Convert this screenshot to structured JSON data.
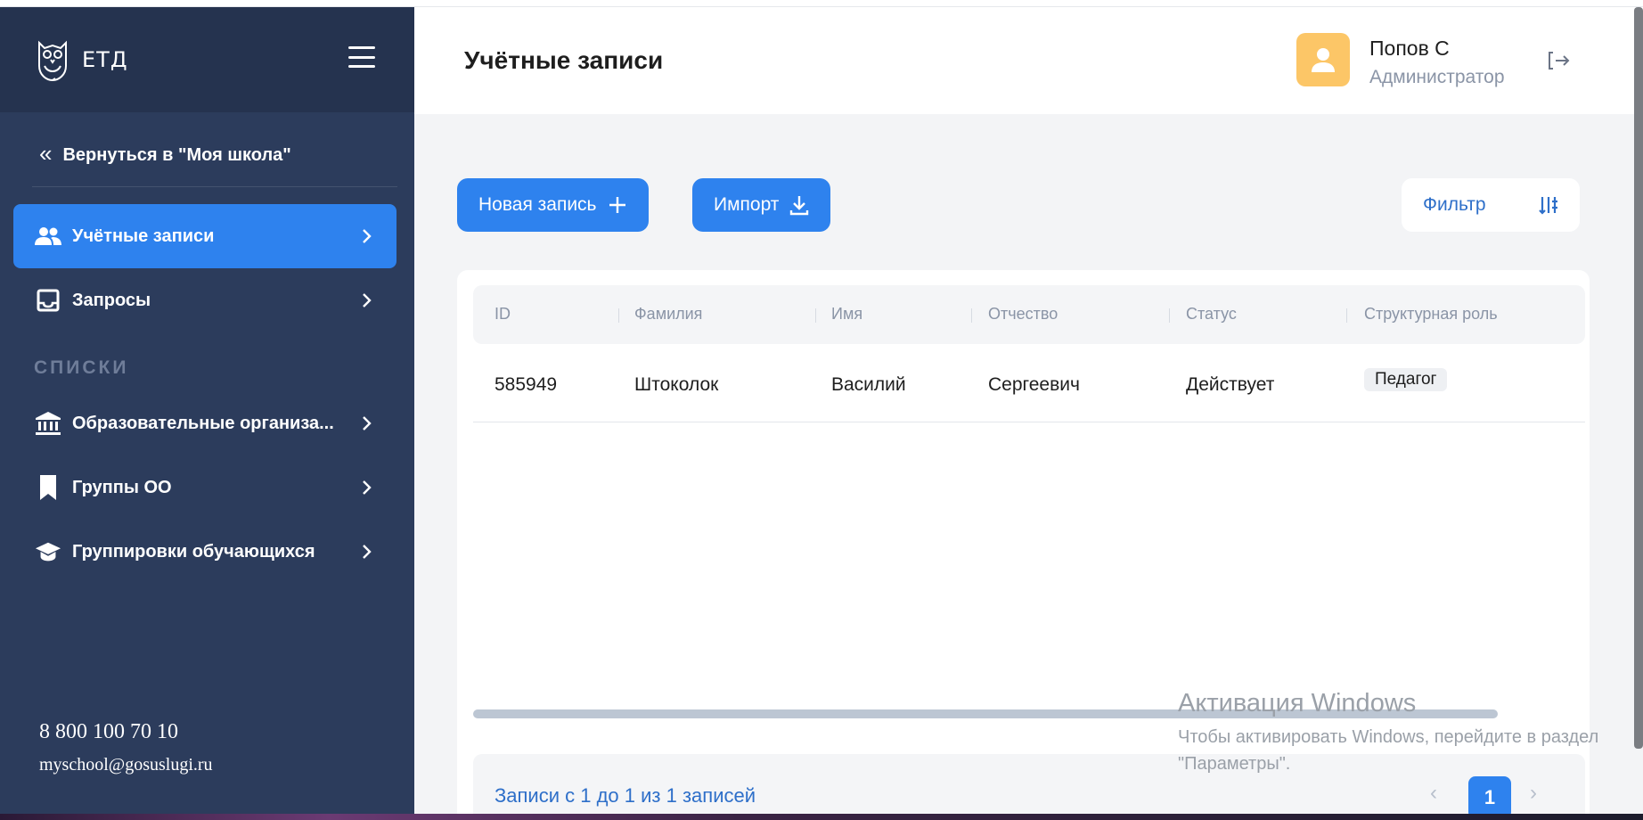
{
  "sidebar": {
    "logo_text": "ЕТД",
    "back_link": "Вернуться в \"Моя школа\"",
    "items": [
      {
        "label": "Учётные записи",
        "icon": "users-icon",
        "active": true
      },
      {
        "label": "Запросы",
        "icon": "inbox-icon",
        "active": false
      }
    ],
    "section_title": "СПИСКИ",
    "list_items": [
      {
        "label": "Образовательные организа...",
        "icon": "institution-icon"
      },
      {
        "label": "Группы ОО",
        "icon": "bookmark-icon"
      },
      {
        "label": "Группировки обучающихся",
        "icon": "graduation-cap-icon"
      }
    ],
    "phone": "8 800 100 70 10",
    "email": "myschool@gosuslugi.ru"
  },
  "header": {
    "title": "Учётные записи",
    "user_name": "Попов С",
    "user_role": "Администратор"
  },
  "toolbar": {
    "new_record": "Новая запись",
    "import": "Импорт",
    "filter": "Фильтр"
  },
  "table": {
    "columns": [
      "ID",
      "Фамилия",
      "Имя",
      "Отчество",
      "Статус",
      "Структурная роль"
    ],
    "rows": [
      {
        "id": "585949",
        "last_name": "Штоколок",
        "first_name": "Василий",
        "patronymic": "Сергеевич",
        "status": "Действует",
        "role": "Педагог"
      }
    ]
  },
  "pagination": {
    "summary": "Записи с 1 до 1 из 1 записей",
    "current_page": "1",
    "prev": "‹",
    "next": "›"
  },
  "windows_activation": {
    "title": "Активация Windows",
    "text": "Чтобы активировать Windows, перейдите в раздел \"Параметры\"."
  },
  "colors": {
    "sidebar_bg": "#2c3c5c",
    "accent": "#2e82ee",
    "avatar_bg": "#fcc667"
  }
}
